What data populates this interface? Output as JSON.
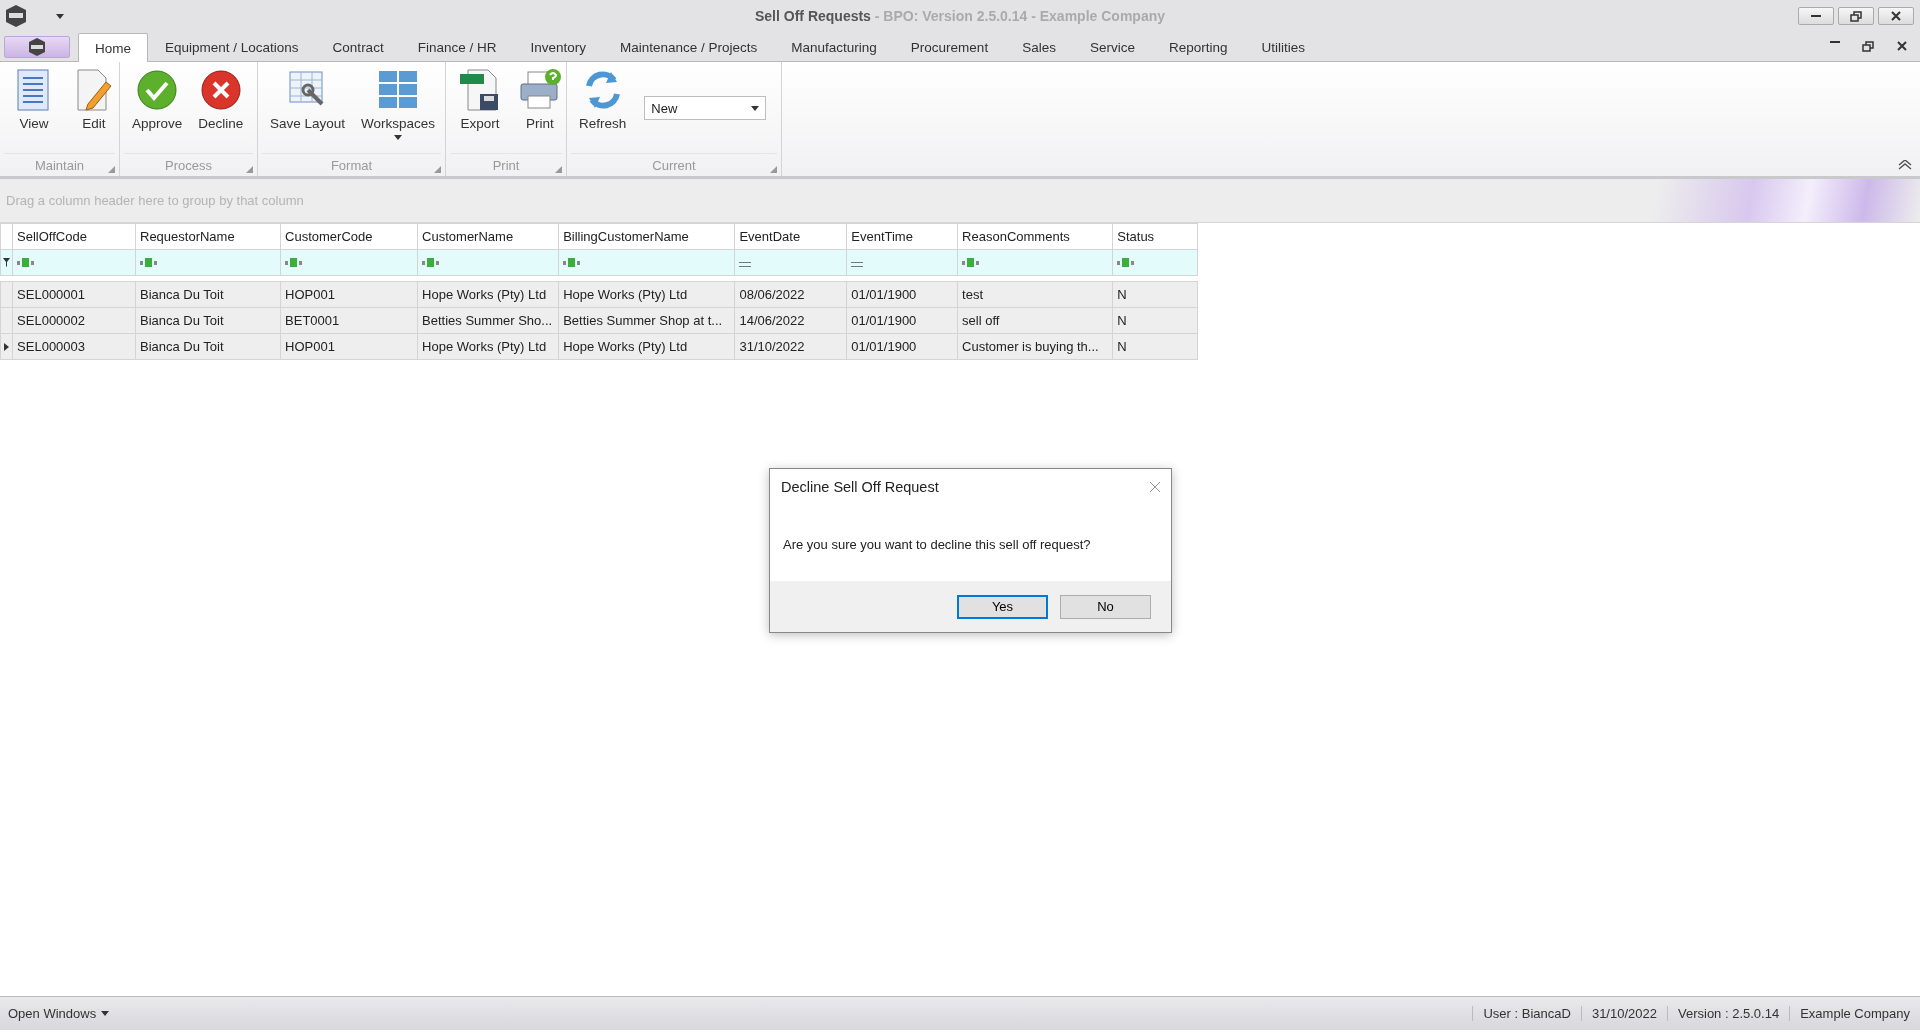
{
  "window": {
    "title": "Sell Off Requests",
    "subtitle": " - BPO: Version 2.5.0.14 - Example Company"
  },
  "tabs": [
    {
      "label": "Home",
      "selected": true
    },
    {
      "label": "Equipment / Locations",
      "selected": false
    },
    {
      "label": "Contract",
      "selected": false
    },
    {
      "label": "Finance / HR",
      "selected": false
    },
    {
      "label": "Inventory",
      "selected": false
    },
    {
      "label": "Maintenance / Projects",
      "selected": false
    },
    {
      "label": "Manufacturing",
      "selected": false
    },
    {
      "label": "Procurement",
      "selected": false
    },
    {
      "label": "Sales",
      "selected": false
    },
    {
      "label": "Service",
      "selected": false
    },
    {
      "label": "Reporting",
      "selected": false
    },
    {
      "label": "Utilities",
      "selected": false
    }
  ],
  "ribbon_groups": [
    {
      "label": "Maintain",
      "items": [
        {
          "kind": "button",
          "label": "View"
        },
        {
          "kind": "button",
          "label": "Edit"
        }
      ]
    },
    {
      "label": "Process",
      "items": [
        {
          "kind": "button",
          "label": "Approve"
        },
        {
          "kind": "button",
          "label": "Decline"
        }
      ]
    },
    {
      "label": "Format",
      "items": [
        {
          "kind": "button",
          "label": "Save Layout"
        },
        {
          "kind": "dropdown",
          "label": "Workspaces"
        }
      ]
    },
    {
      "label": "Print",
      "items": [
        {
          "kind": "button",
          "label": "Export"
        },
        {
          "kind": "button",
          "label": "Print"
        }
      ]
    },
    {
      "label": "Current",
      "items": [
        {
          "kind": "button",
          "label": "Refresh"
        },
        {
          "kind": "combo",
          "value": "New"
        }
      ]
    }
  ],
  "grid": {
    "group_hint": "Drag a column header here to group by that column",
    "columns": [
      {
        "label": "SellOffCode",
        "kind": "text"
      },
      {
        "label": "RequestorName",
        "kind": "text"
      },
      {
        "label": "CustomerCode",
        "kind": "text"
      },
      {
        "label": "CustomerName",
        "kind": "text"
      },
      {
        "label": "BillingCustomerName",
        "kind": "text"
      },
      {
        "label": "EventDate",
        "kind": "date"
      },
      {
        "label": "EventTime",
        "kind": "date"
      },
      {
        "label": "ReasonComments",
        "kind": "text"
      },
      {
        "label": "Status",
        "kind": "text"
      }
    ],
    "rows": [
      {
        "focused": false,
        "cells": [
          "SEL000001",
          "Bianca Du Toit",
          "HOP001",
          "Hope Works (Pty) Ltd",
          "Hope Works (Pty) Ltd",
          "08/06/2022",
          "01/01/1900",
          "test",
          "N"
        ]
      },
      {
        "focused": false,
        "cells": [
          "SEL000002",
          "Bianca Du Toit",
          "BET0001",
          "Betties Summer Sho...",
          "Betties Summer Shop at t...",
          "14/06/2022",
          "01/01/1900",
          "sell off",
          "N"
        ]
      },
      {
        "focused": true,
        "cells": [
          "SEL000003",
          "Bianca Du Toit",
          "HOP001",
          "Hope Works (Pty) Ltd",
          "Hope Works (Pty) Ltd",
          "31/10/2022",
          "01/01/1900",
          "Customer is buying th...",
          "N"
        ]
      }
    ]
  },
  "dialog": {
    "title": "Decline Sell Off Request",
    "message": "Are you sure you want to decline this sell off request?",
    "buttons": [
      {
        "label": "Yes",
        "focused": true
      },
      {
        "label": "No",
        "focused": false
      }
    ]
  },
  "status_bar": {
    "left": "Open Windows",
    "right": [
      "User : BiancaD",
      "31/10/2022",
      "Version : 2.5.0.14",
      "Example Company"
    ]
  }
}
